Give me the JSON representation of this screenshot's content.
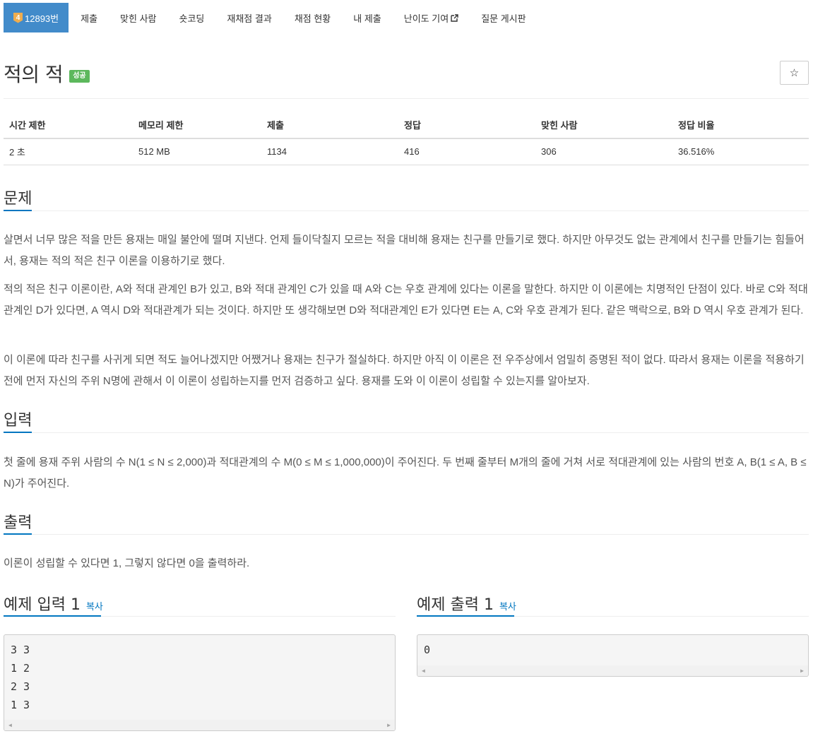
{
  "nav": {
    "problem_number": "12893번",
    "level_badge": "4",
    "items": [
      "제출",
      "맞힌 사람",
      "숏코딩",
      "재채점 결과",
      "채점 현황",
      "내 제출",
      "난이도 기여",
      "질문 게시판"
    ]
  },
  "problem": {
    "title": "적의 적",
    "status": "성공",
    "star": "☆"
  },
  "info_table": {
    "headers": [
      "시간 제한",
      "메모리 제한",
      "제출",
      "정답",
      "맞힌 사람",
      "정답 비율"
    ],
    "values": [
      "2 초",
      "512 MB",
      "1134",
      "416",
      "306",
      "36.516%"
    ]
  },
  "sections": {
    "description_title": "문제",
    "description": [
      "살면서 너무 많은 적을 만든 용재는 매일 불안에 떨며 지낸다. 언제 들이닥칠지 모르는 적을 대비해 용재는 친구를 만들기로 했다. 하지만 아무것도 없는 관계에서 친구를 만들기는 힘들어서, 용재는 적의 적은 친구 이론을 이용하기로 했다.",
      "적의 적은 친구 이론이란, A와 적대 관계인 B가 있고, B와 적대 관계인 C가 있을 때 A와 C는 우호 관계에 있다는 이론을 말한다. 하지만 이 이론에는 치명적인 단점이 있다. 바로 C와 적대 관계인 D가 있다면, A 역시 D와 적대관계가 되는 것이다. 하지만 또 생각해보면 D와 적대관계인 E가 있다면 E는 A, C와 우호 관계가 된다. 같은 맥락으로, B와 D 역시 우호 관계가 된다.",
      "이 이론에 따라 친구를 사귀게 되면 적도 늘어나겠지만 어쨌거나 용재는 친구가 절실하다. 하지만 아직 이 이론은 전 우주상에서 엄밀히 증명된 적이 없다. 따라서 용재는 이론을 적용하기 전에 먼저 자신의 주위 N명에 관해서 이 이론이 성립하는지를 먼저 검증하고 싶다. 용재를 도와 이 이론이 성립할 수 있는지를 알아보자."
    ],
    "input_title": "입력",
    "input": "첫 줄에 용재 주위 사람의 수 N(1 ≤ N ≤ 2,000)과 적대관계의 수 M(0 ≤ M ≤ 1,000,000)이 주어진다. 두 번째 줄부터 M개의 줄에 거쳐 서로 적대관계에 있는 사람의 번호 A, B(1 ≤ A, B ≤ N)가 주어진다.",
    "output_title": "출력",
    "output": "이론이 성립할 수 있다면 1, 그렇지 않다면 0을 출력하라."
  },
  "samples": {
    "input_title": "예제 입력 1",
    "output_title": "예제 출력 1",
    "copy_label": "복사",
    "input": "3 3\n1 2\n2 3\n1 3",
    "output": "0"
  },
  "colors": {
    "nav_active": "#428bca",
    "level_badge": "#f0ad4e",
    "success": "#5cb85c",
    "link": "#0076c0"
  },
  "icons": {
    "external_link": "external-link-icon",
    "star": "star-icon",
    "scroll_left": "arrow-left-icon",
    "scroll_right": "arrow-right-icon"
  }
}
